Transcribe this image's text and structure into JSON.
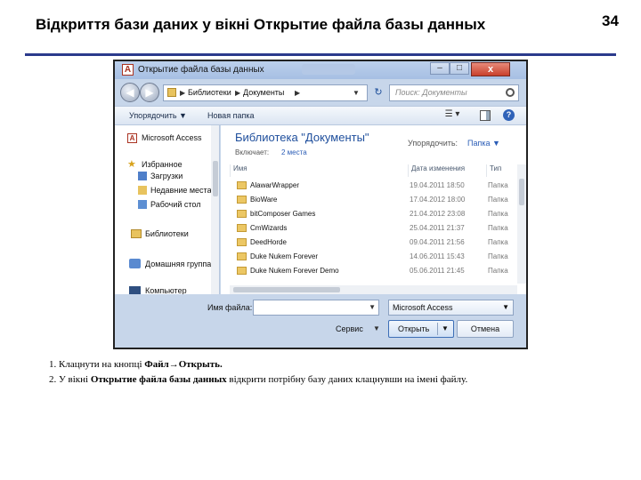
{
  "slide": {
    "title": "Відкриття бази даних у вікні Открытие файла базы данных",
    "page_number": "34"
  },
  "dialog": {
    "title": "Открытие файла базы данных",
    "title_icon": "access-icon",
    "window_buttons": {
      "minimize": "–",
      "maximize": "□",
      "close": "x"
    },
    "address": {
      "crumbs": [
        "Библиотеки",
        "Документы"
      ],
      "search_placeholder": "Поиск: Документы"
    },
    "toolbar": {
      "organize_label": "Упорядочить ▼",
      "new_folder_label": "Новая папка"
    },
    "nav_pane": {
      "access_label": "Microsoft Access",
      "favorites_label": "Избранное",
      "downloads_label": "Загрузки",
      "recent_places_label": "Недавние места",
      "desktop_label": "Рабочий стол",
      "libraries_label": "Библиотеки",
      "homegroup_label": "Домашняя группа",
      "computer_label": "Компьютер"
    },
    "library": {
      "title": "Библиотека \"Документы\"",
      "includes_label": "Включает:",
      "includes_value": "2 места",
      "arrange_label": "Упорядочить:",
      "arrange_value": "Папка ▼"
    },
    "columns": [
      "Имя",
      "Дата изменения",
      "Тип"
    ],
    "files": [
      {
        "name": "AlawarWrapper",
        "date": "19.04.2011 18:50",
        "type": "Папка"
      },
      {
        "name": "BioWare",
        "date": "17.04.2012 18:00",
        "type": "Папка"
      },
      {
        "name": "bitComposer Games",
        "date": "21.04.2012 23:08",
        "type": "Папка"
      },
      {
        "name": "CmWizards",
        "date": "25.04.2011 21:37",
        "type": "Папка"
      },
      {
        "name": "DeedHorde",
        "date": "09.04.2011 21:56",
        "type": "Папка"
      },
      {
        "name": "Duke Nukem Forever",
        "date": "14.06.2011 15:43",
        "type": "Папка"
      },
      {
        "name": "Duke Nukem Forever Demo",
        "date": "05.06.2011 21:45",
        "type": "Папка"
      }
    ],
    "filename_label": "Имя файла:",
    "filename_value": "",
    "filetype_value": "Microsoft Access",
    "service_label": "Сервис",
    "open_label": "Открыть",
    "cancel_label": "Отмена"
  },
  "steps": {
    "s1_prefix": "1. Клацнути на кнопці ",
    "s1_bold": "Файл→Открыть.",
    "s2_prefix": "2. У вікні ",
    "s2_bold": "Открытие файла базы данных",
    "s2_suffix": " відкрити потрібну базу даних клацнувши на імені файлу."
  }
}
